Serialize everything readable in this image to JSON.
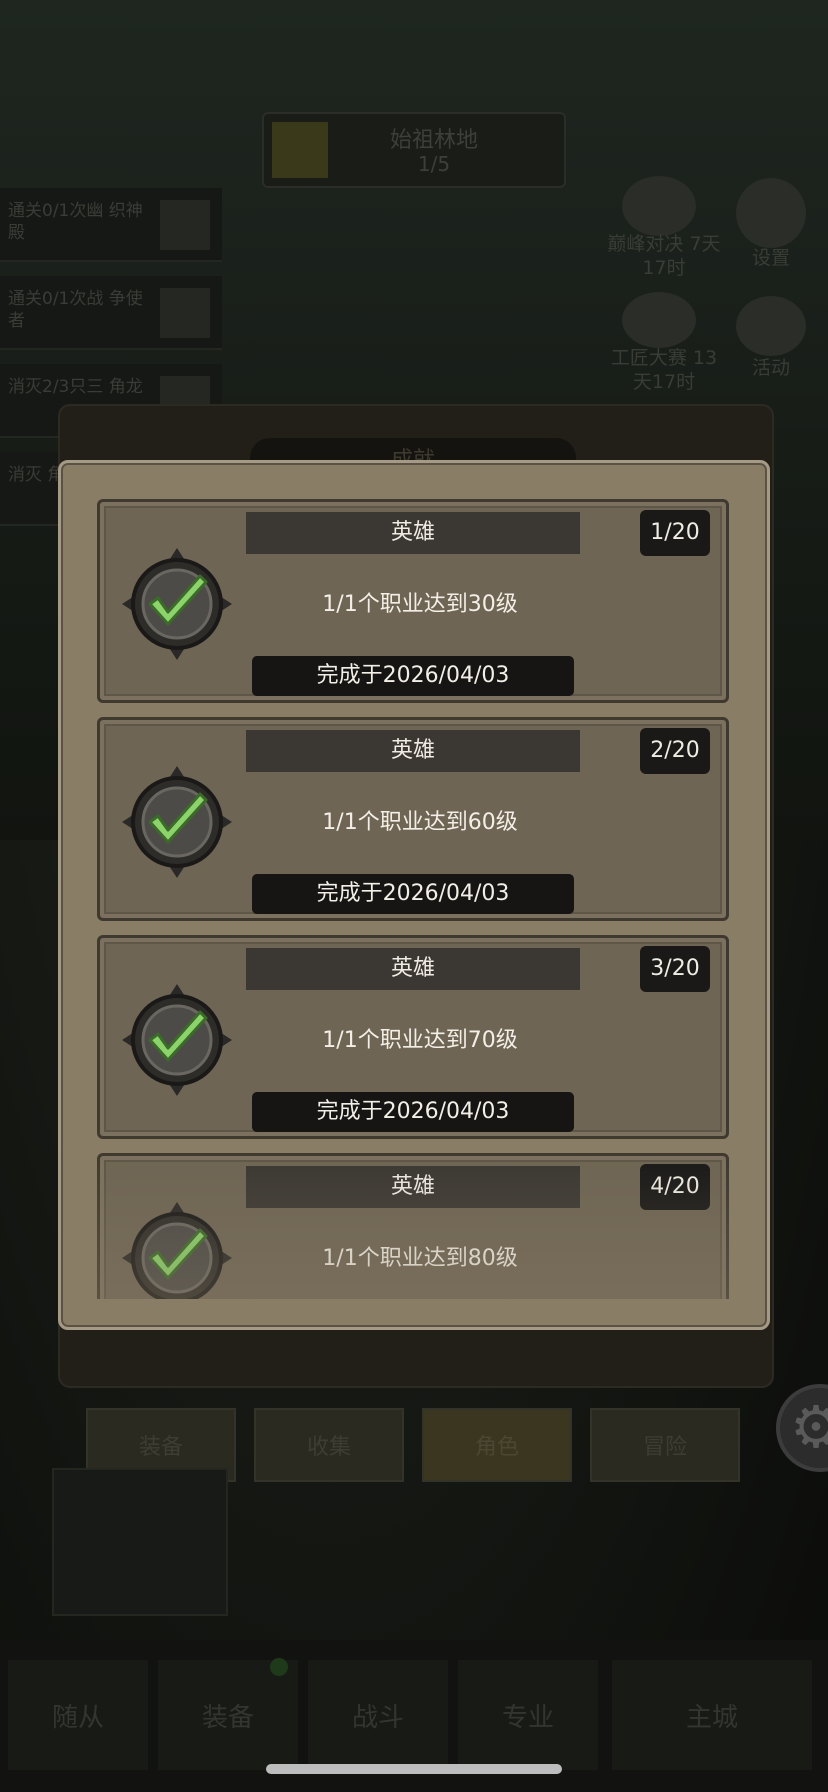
{
  "background": {
    "stage": {
      "name": "始祖林地",
      "count": "1/5"
    },
    "quests": [
      "通关0/1次幽 织神殿",
      "通关0/1次战 争使者",
      "消灭2/3只三 角龙",
      "消灭 角龙"
    ],
    "side_buttons": [
      {
        "label": "巅峰对决 7天17时",
        "icon": "event-icon"
      },
      {
        "label": "设置",
        "icon": "gear-icon"
      },
      {
        "label": "工匠大赛 13天17时",
        "icon": "anvil-icon"
      },
      {
        "label": "活动",
        "icon": "calendar-icon"
      }
    ],
    "backpanel_title": "成就",
    "tabs": [
      "装备",
      "收集",
      "角色",
      "冒险"
    ],
    "active_tab": "角色",
    "bottom_nav": [
      "随从",
      "装备",
      "战斗",
      "专业",
      "主城"
    ]
  },
  "achievements": [
    {
      "title": "英雄",
      "progress": "1/20",
      "desc": "1/1个职业达到30级",
      "completed": "完成于2026/04/03",
      "icon": "check-badge-icon"
    },
    {
      "title": "英雄",
      "progress": "2/20",
      "desc": "1/1个职业达到60级",
      "completed": "完成于2026/04/03",
      "icon": "check-badge-icon"
    },
    {
      "title": "英雄",
      "progress": "3/20",
      "desc": "1/1个职业达到70级",
      "completed": "完成于2026/04/03",
      "icon": "check-badge-icon"
    },
    {
      "title": "英雄",
      "progress": "4/20",
      "desc": "1/1个职业达到80级",
      "completed": "",
      "icon": "check-badge-icon"
    }
  ],
  "colors": {
    "modal": "#8a7d66",
    "card": "#6f6554",
    "check": "#8bd36a"
  }
}
